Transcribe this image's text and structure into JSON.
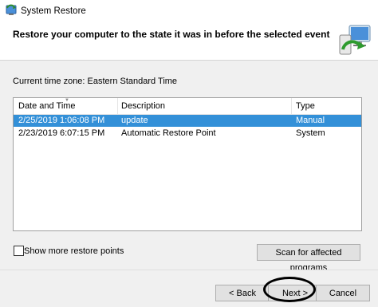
{
  "window": {
    "title": "System Restore"
  },
  "header": {
    "text": "Restore your computer to the state it was in before the selected event"
  },
  "timezone": "Current time zone: Eastern Standard Time",
  "table": {
    "columns": [
      "Date and Time",
      "Description",
      "Type"
    ],
    "rows": [
      {
        "date": "2/25/2019 1:06:08 PM",
        "description": "update",
        "type": "Manual",
        "selected": true
      },
      {
        "date": "2/23/2019 6:07:15 PM",
        "description": "Automatic Restore Point",
        "type": "System",
        "selected": false
      }
    ]
  },
  "options": {
    "show_more_label": "Show more restore points",
    "show_more_checked": false
  },
  "buttons": {
    "scan": "Scan for affected programs",
    "back": "< Back",
    "next": "Next >",
    "cancel": "Cancel"
  },
  "colors": {
    "selection": "#3390d8",
    "panel": "#f0f0f0"
  }
}
